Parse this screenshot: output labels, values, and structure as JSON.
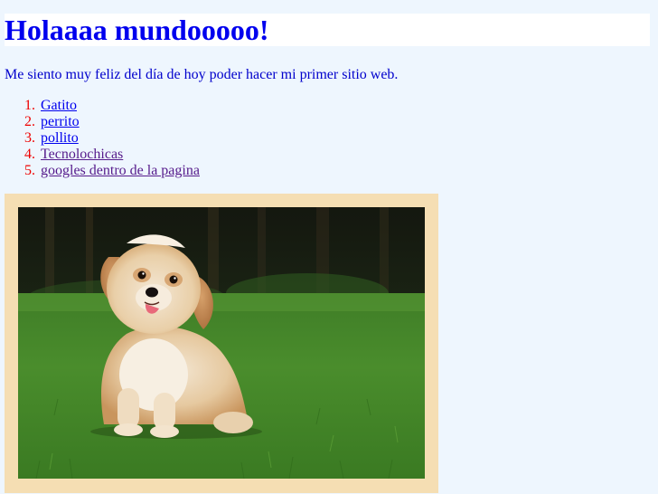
{
  "header": {
    "title": "Holaaaa mundooooo!"
  },
  "intro": {
    "text": "Me siento muy feliz del día de hoy poder hacer mi primer sitio web."
  },
  "links": [
    {
      "label": "Gatito",
      "visited": false
    },
    {
      "label": "perrito",
      "visited": false
    },
    {
      "label": "pollito",
      "visited": false
    },
    {
      "label": "Tecnolochicas",
      "visited": true
    },
    {
      "label": "googles dentro de la pagina",
      "visited": true
    }
  ],
  "photo": {
    "subject": "puppy-sitting-on-grass",
    "frame_color": "#f5deb3"
  },
  "colors": {
    "background": "#eef6fe",
    "title": "#0000ee",
    "link": "#0000ee",
    "visited_link": "#551a8b",
    "list_marker": "#ee0000"
  }
}
